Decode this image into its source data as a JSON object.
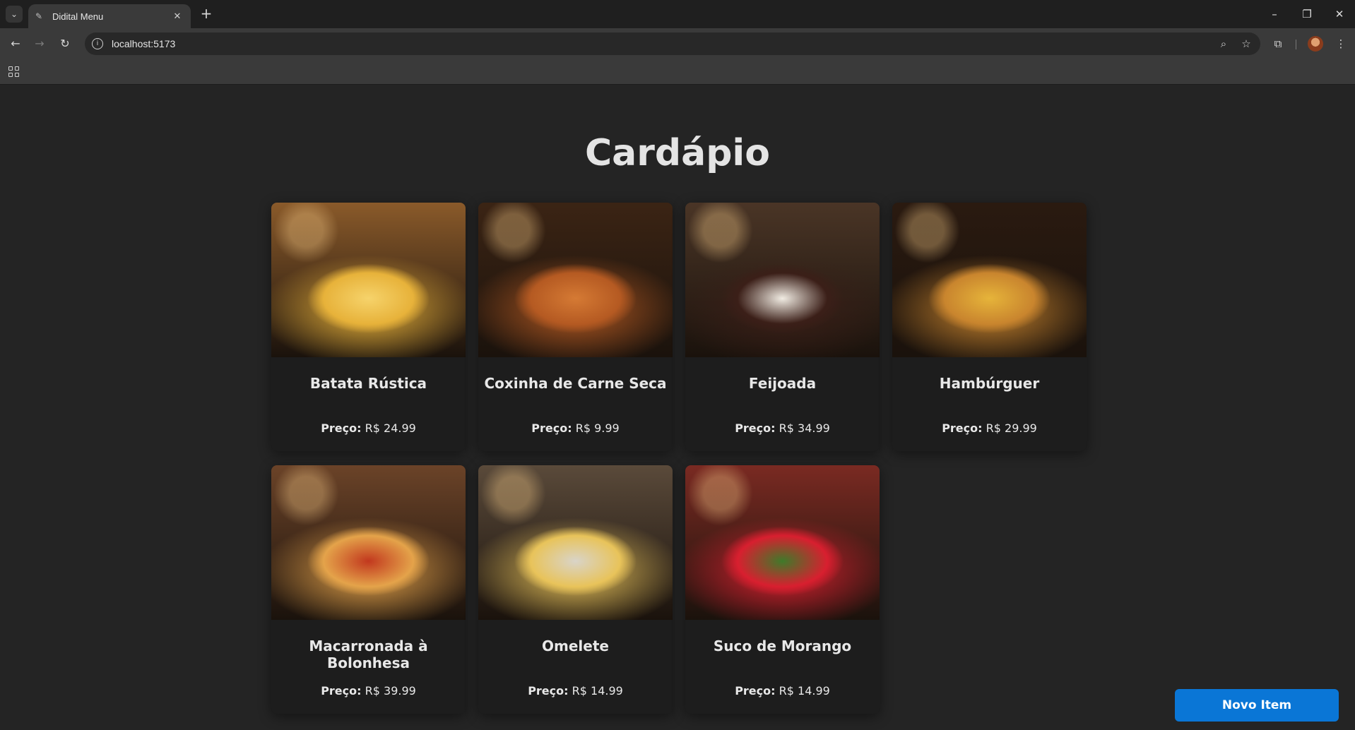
{
  "browser": {
    "tab_title": "Didital Menu",
    "url": "localhost:5173"
  },
  "page": {
    "title": "Cardápio",
    "price_label": "Preço:",
    "new_item_button": "Novo Item"
  },
  "items": [
    {
      "name": "Batata Rústica",
      "price": "R$ 24.99",
      "image": "rustic-potatoes",
      "colors": [
        "#8a5a2a",
        "#e7b23a",
        "#f6d36b"
      ]
    },
    {
      "name": "Coxinha de Carne Seca",
      "price": "R$ 9.99",
      "image": "coxinha",
      "colors": [
        "#3b2414",
        "#b55a22",
        "#d57a34"
      ]
    },
    {
      "name": "Feijoada",
      "price": "R$ 34.99",
      "image": "feijoada",
      "colors": [
        "#4a3526",
        "#3b1f18",
        "#f1ece3"
      ]
    },
    {
      "name": "Hambúrguer",
      "price": "R$ 29.99",
      "image": "burger",
      "colors": [
        "#2a1a10",
        "#c9852e",
        "#e6b43a"
      ]
    },
    {
      "name": "Macarronada à Bolonhesa",
      "price": "R$ 39.99",
      "image": "pasta-bolognese",
      "colors": [
        "#6b4328",
        "#e4a34a",
        "#c2381e"
      ]
    },
    {
      "name": "Omelete",
      "price": "R$ 14.99",
      "image": "omelette",
      "colors": [
        "#5a4a3a",
        "#e8c35a",
        "#d9d4c8"
      ]
    },
    {
      "name": "Suco de Morango",
      "price": "R$ 14.99",
      "image": "strawberry-juice",
      "colors": [
        "#7a2a22",
        "#d81f2f",
        "#3f7a2a"
      ]
    }
  ]
}
